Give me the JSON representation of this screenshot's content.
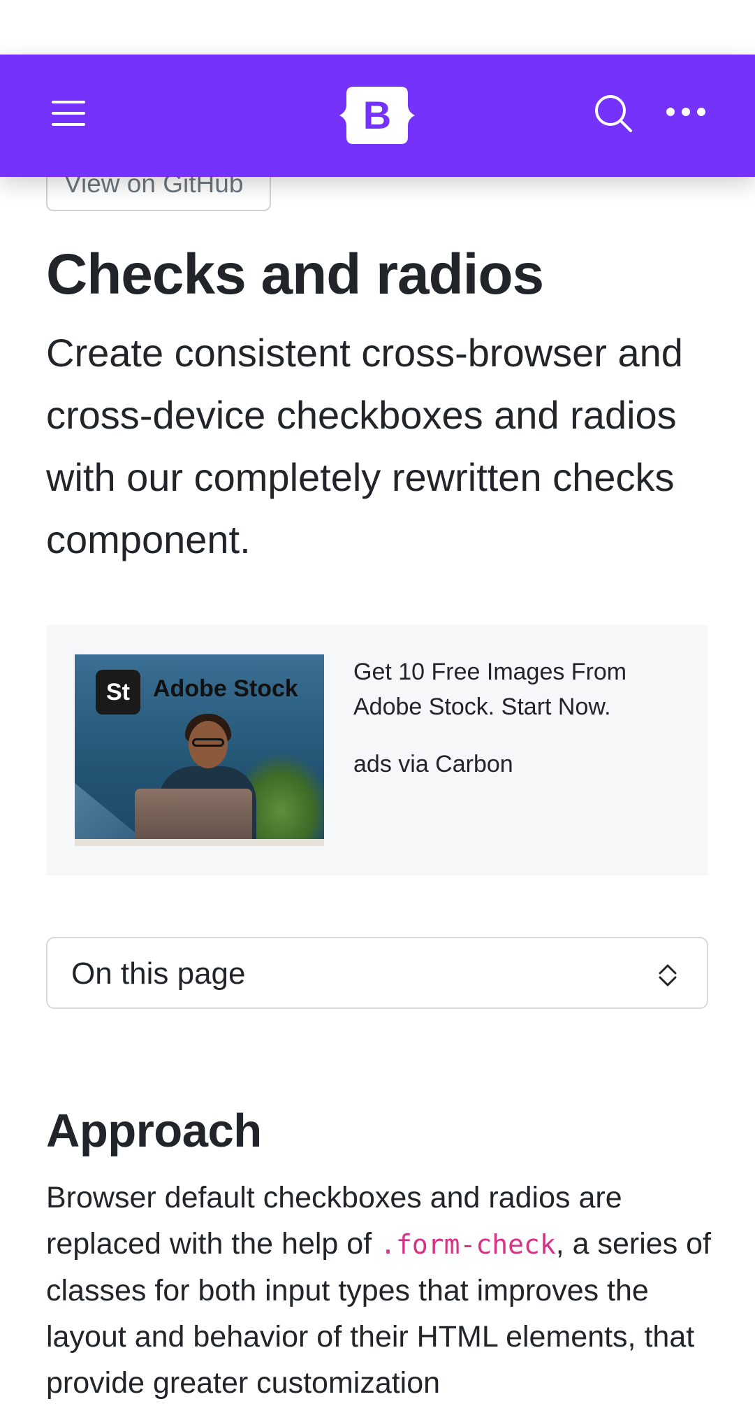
{
  "navbar": {
    "background": "#7532fa",
    "menu_icon": "hamburger-menu-icon",
    "logo_letter": "B",
    "search_icon": "search-icon",
    "more_icon": "more-dots-icon"
  },
  "header": {
    "github_button": "View on GitHub",
    "title": "Checks and radios",
    "lead": "Create consistent cross-browser and cross-device checkboxes and radios with our completely rewritten checks component."
  },
  "ad": {
    "brand_badge": "St",
    "brand_name": "Adobe Stock",
    "text": "Get 10 Free Images From Adobe Stock. Start Now.",
    "via": "ads via Carbon"
  },
  "toc": {
    "label": "On this page",
    "icon": "chevron-up-down-icon"
  },
  "section": {
    "heading": "Approach",
    "para_before_code": "Browser default checkboxes and radios are replaced with the help of ",
    "code": ".form-check",
    "para_after_code": ", a series of classes for both input types that improves the layout and behavior of their HTML elements, that provide greater customization"
  }
}
